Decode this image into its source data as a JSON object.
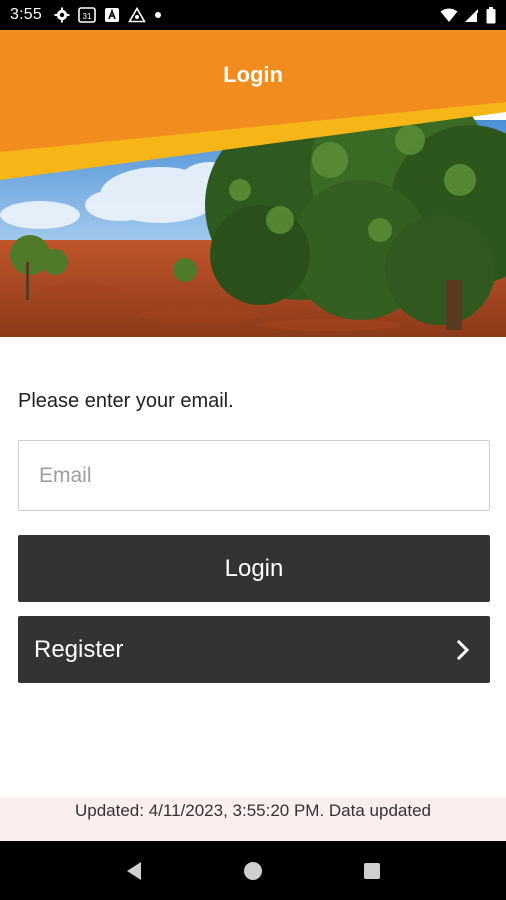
{
  "status_bar": {
    "time": "3:55",
    "calendar_day": "31",
    "icons_left": [
      "gear-icon",
      "calendar-icon",
      "a-badge-icon",
      "recycle-icon",
      "dot-icon"
    ],
    "icons_right": [
      "wifi-icon",
      "signal-icon",
      "battery-icon"
    ]
  },
  "header": {
    "title": "Login",
    "brand_color": "#F28C1E",
    "stripe_color": "#F7B617"
  },
  "form": {
    "prompt": "Please enter your email.",
    "email_placeholder": "Email",
    "email_value": "",
    "login_label": "Login",
    "register_label": "Register"
  },
  "footer": {
    "updated_text": "Updated: 4/11/2023, 3:55:20 PM. Data updated"
  },
  "nav": {
    "back": "back-icon",
    "home": "home-icon",
    "recents": "recents-icon"
  }
}
